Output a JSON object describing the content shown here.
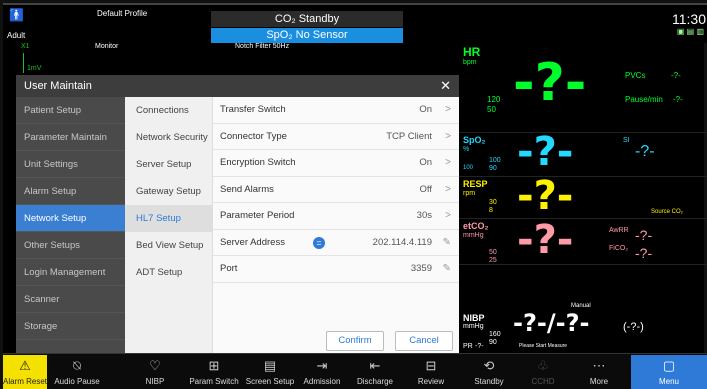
{
  "topbar": {
    "patient_type": "Adult",
    "profile": "Default Profile",
    "status1": "CO₂ Standby",
    "status2": "SpO₂ No Sensor",
    "notch": "Notch Filter 50Hz",
    "time": "11:30"
  },
  "monitor_strip": {
    "label": "Monitor",
    "lead": "X1",
    "scale": "1mV"
  },
  "dialog": {
    "title": "User Maintain",
    "close": "✕",
    "col1": [
      "Patient Setup",
      "Parameter Maintain",
      "Unit Settings",
      "Alarm Setup",
      "Network Setup",
      "Other Setups",
      "Login Management",
      "Scanner",
      "Storage"
    ],
    "col2": [
      "Connections",
      "Network Security",
      "Server Setup",
      "Gateway Setup",
      "HL7 Setup",
      "Bed View Setup",
      "ADT Setup"
    ],
    "rows": [
      {
        "label": "Transfer Switch",
        "value": "On",
        "icon": "chevron-right"
      },
      {
        "label": "Connector Type",
        "value": "TCP Client",
        "icon": "chevron-right"
      },
      {
        "label": "Encryption Switch",
        "value": "On",
        "icon": "chevron-right"
      },
      {
        "label": "Send Alarms",
        "value": "Off",
        "icon": "chevron-right"
      },
      {
        "label": "Parameter Period",
        "value": "30s",
        "icon": "chevron-right"
      },
      {
        "label": "Server Address",
        "value": "202.114.4.119",
        "icon": "pencil"
      },
      {
        "label": "Port",
        "value": "3359",
        "icon": "pencil"
      }
    ],
    "confirm": "Confirm",
    "cancel": "Cancel"
  },
  "vitals": {
    "hr": {
      "label": "HR",
      "unit": "bpm",
      "hi": "120",
      "lo": "50",
      "value": "-?-",
      "pvcs": "PVCs",
      "pvcs_v": "-?-",
      "pause": "Pause/min",
      "pause_v": "-?-"
    },
    "spo2": {
      "label": "SpO₂",
      "unit": "%",
      "hi": "100",
      "lo": "90",
      "value": "-?-",
      "si": "SI",
      "si_v": "-?-",
      "pi": "100"
    },
    "resp": {
      "label": "RESP",
      "unit": "rpm",
      "hi": "30",
      "lo": "8",
      "value": "-?-",
      "source": "Source CO₂"
    },
    "etco2": {
      "label": "etCO₂",
      "unit": "mmHg",
      "hi": "50",
      "lo": "25",
      "value": "-?-",
      "awrr": "AwRR",
      "awrr_v": "-?-",
      "fico2": "FiCO₂",
      "fico2_v": "-?-"
    },
    "nibp": {
      "label": "NIBP",
      "unit": "mmHg",
      "hi": "160",
      "lo": "90",
      "value": "-?-/-?-",
      "mean": "(-?-)",
      "mode": "Manual",
      "msg": "Please Start Measure",
      "pr": "PR",
      "pr_v": "-?-"
    }
  },
  "toolbar": [
    "Alarm Reset",
    "Audio Pause",
    "NIBP",
    "Param Switch",
    "Screen Setup",
    "Admission",
    "Discharge",
    "Review",
    "Standby",
    "CCHD",
    "More",
    "Menu"
  ],
  "colors": {
    "hr": "#00ff2a",
    "spo2": "#22d9ff",
    "resp": "#fff200",
    "etco2": "#ff9aa8",
    "accent": "#3a7fd1",
    "alarm_reset": "#f5e100",
    "menu": "#2e7ad6"
  }
}
